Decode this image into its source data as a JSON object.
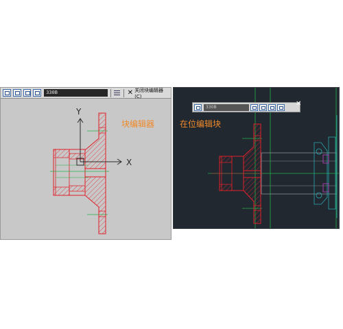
{
  "colors": {
    "left_bg": "#c8c8c8",
    "right_bg": "#212830",
    "hatch_red": "#e0202a",
    "green": "#22b04a",
    "label_orange": "#f08a2a",
    "axis": "#2a2a2a"
  },
  "left": {
    "toolbar": {
      "block_name": "330B",
      "close_label": "关闭块编辑器(C)",
      "icons": [
        "save-block-icon",
        "save-block-as-icon",
        "block-definition-icon",
        "attribute-icon",
        "block-list-icon",
        "close-icon"
      ]
    },
    "label": "块编辑器",
    "ucs": {
      "y_label": "Y",
      "x_label": "X"
    }
  },
  "right": {
    "toolbar": {
      "block_name": "330B",
      "icons": [
        "refedit-icon",
        "add-to-working-set-icon",
        "remove-from-working-set-icon",
        "discard-changes-icon",
        "save-changes-icon",
        "close-icon"
      ]
    },
    "label": "在位编辑块"
  }
}
